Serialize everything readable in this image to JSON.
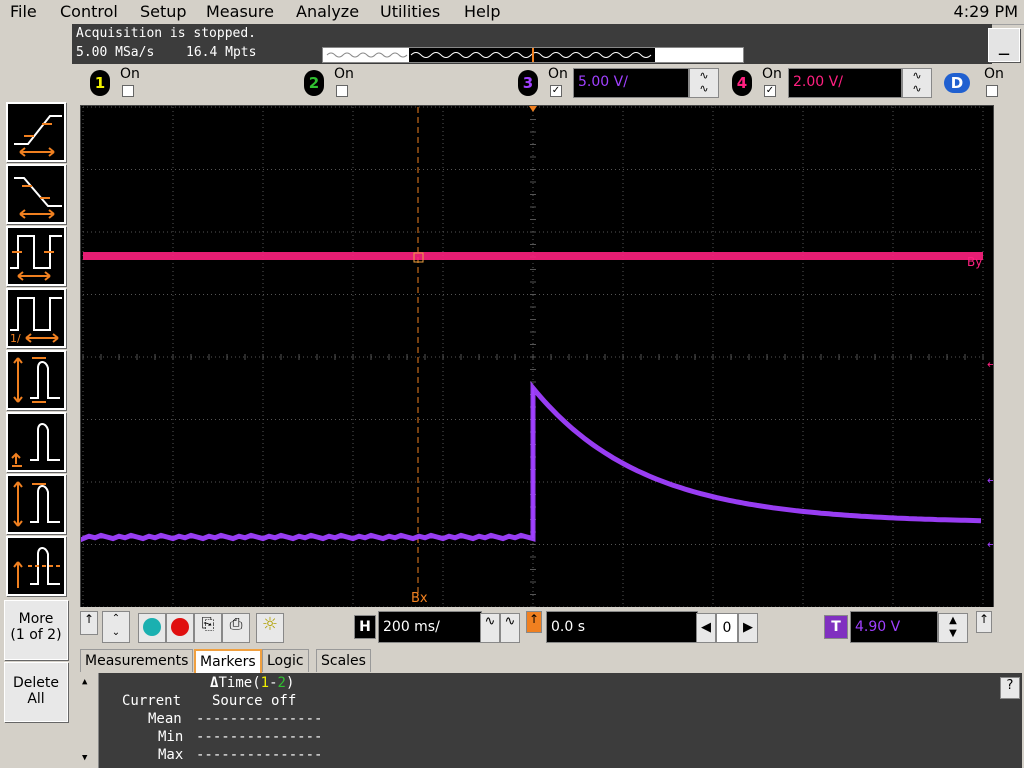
{
  "menu": [
    "File",
    "Control",
    "Setup",
    "Measure",
    "Analyze",
    "Utilities",
    "Help"
  ],
  "clock": "4:29 PM",
  "status": {
    "line1": "Acquisition is stopped.",
    "sample_rate": "5.00 MSa/s",
    "memory": "16.4 Mpts"
  },
  "minimize_label": "_",
  "channels": [
    {
      "num": "1",
      "on_label": "On",
      "checked": false,
      "color": "#f0f000"
    },
    {
      "num": "2",
      "on_label": "On",
      "checked": false,
      "color": "#30c030"
    },
    {
      "num": "3",
      "on_label": "On",
      "checked": true,
      "scale": "5.00 V/",
      "color": "#a040ff"
    },
    {
      "num": "4",
      "on_label": "On",
      "checked": true,
      "scale": "2.00 V/",
      "color": "#ff2080"
    },
    {
      "num": "D",
      "on_label": "On",
      "checked": false,
      "color": "#2060d0"
    }
  ],
  "side_buttons": {
    "more": "More",
    "more_sub": "(1 of 2)",
    "delete": "Delete",
    "delete_sub": "All"
  },
  "screen": {
    "marker_bx": "Bx",
    "marker_by": "By",
    "ch4_marker": "4",
    "trig_marker": "T",
    "ch3_marker": "3",
    "grid_bg": "#000000",
    "grid_color": "#555555"
  },
  "controls": {
    "timebase": "200 ms/",
    "delay": "0.0 s",
    "zoom_value": "0",
    "trig_level": "4.90 V",
    "h_label": "H",
    "t_label": "T"
  },
  "tabs": [
    {
      "label": "Measurements",
      "active": false
    },
    {
      "label": "Markers",
      "active": true
    },
    {
      "label": "Logic",
      "active": false
    },
    {
      "label": "Scales",
      "active": false
    }
  ],
  "measurements": {
    "header": "ΔTime(1-2)",
    "rows": [
      {
        "label": "Current",
        "value": "Source off"
      },
      {
        "label": "Mean",
        "value": "---------------"
      },
      {
        "label": "Min",
        "value": "---------------"
      },
      {
        "label": "Max",
        "value": "---------------"
      }
    ]
  },
  "help_label": "?"
}
